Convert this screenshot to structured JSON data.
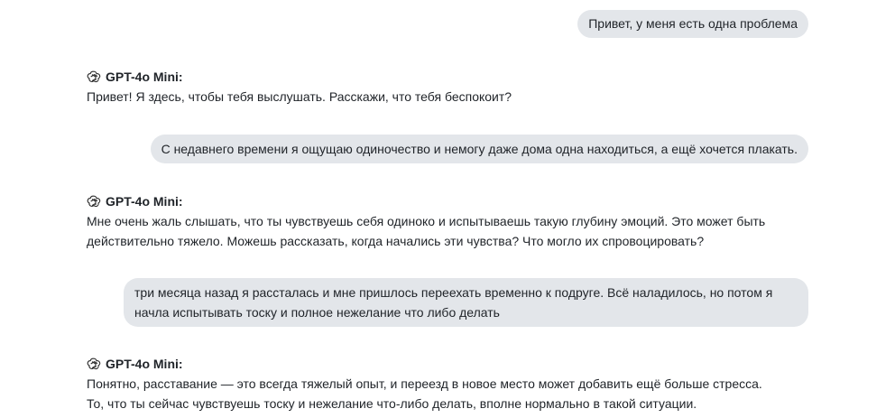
{
  "chat": {
    "assistant_name": "GPT-4o Mini:",
    "messages": [
      {
        "role": "user",
        "text": "Привет, у меня есть одна проблема"
      },
      {
        "role": "assistant",
        "text": "Привет! Я здесь, чтобы тебя выслушать. Расскажи, что тебя беспокоит?"
      },
      {
        "role": "user",
        "text": "С недавнего времени я ощущаю одиночество и немогу даже дома одна находиться, а ещё хочется плакать."
      },
      {
        "role": "assistant",
        "lines": [
          "Мне очень жаль слышать, что ты чувствуешь себя одиноко и испытываешь такую глубину эмоций. Это может быть",
          "действительно тяжело. Можешь рассказать, когда начались эти чувства? Что могло их спровоцировать?"
        ]
      },
      {
        "role": "user",
        "lines": [
          "три месяца назад я рассталась и мне пришлось переехать временно к подруге. Всё наладилось, но потом я",
          "начла испытывать тоску и полное нежелание что либо делать"
        ]
      },
      {
        "role": "assistant",
        "lines": [
          "Понятно, расставание — это всегда тяжелый опыт, и переезд в новое место может добавить ещё больше стресса.",
          "То, что ты сейчас чувствуешь тоску и нежелание что-либо делать, вполне нормально в такой ситуации."
        ]
      }
    ]
  },
  "icons": {
    "assistant_logo": "openai-logo-icon"
  }
}
